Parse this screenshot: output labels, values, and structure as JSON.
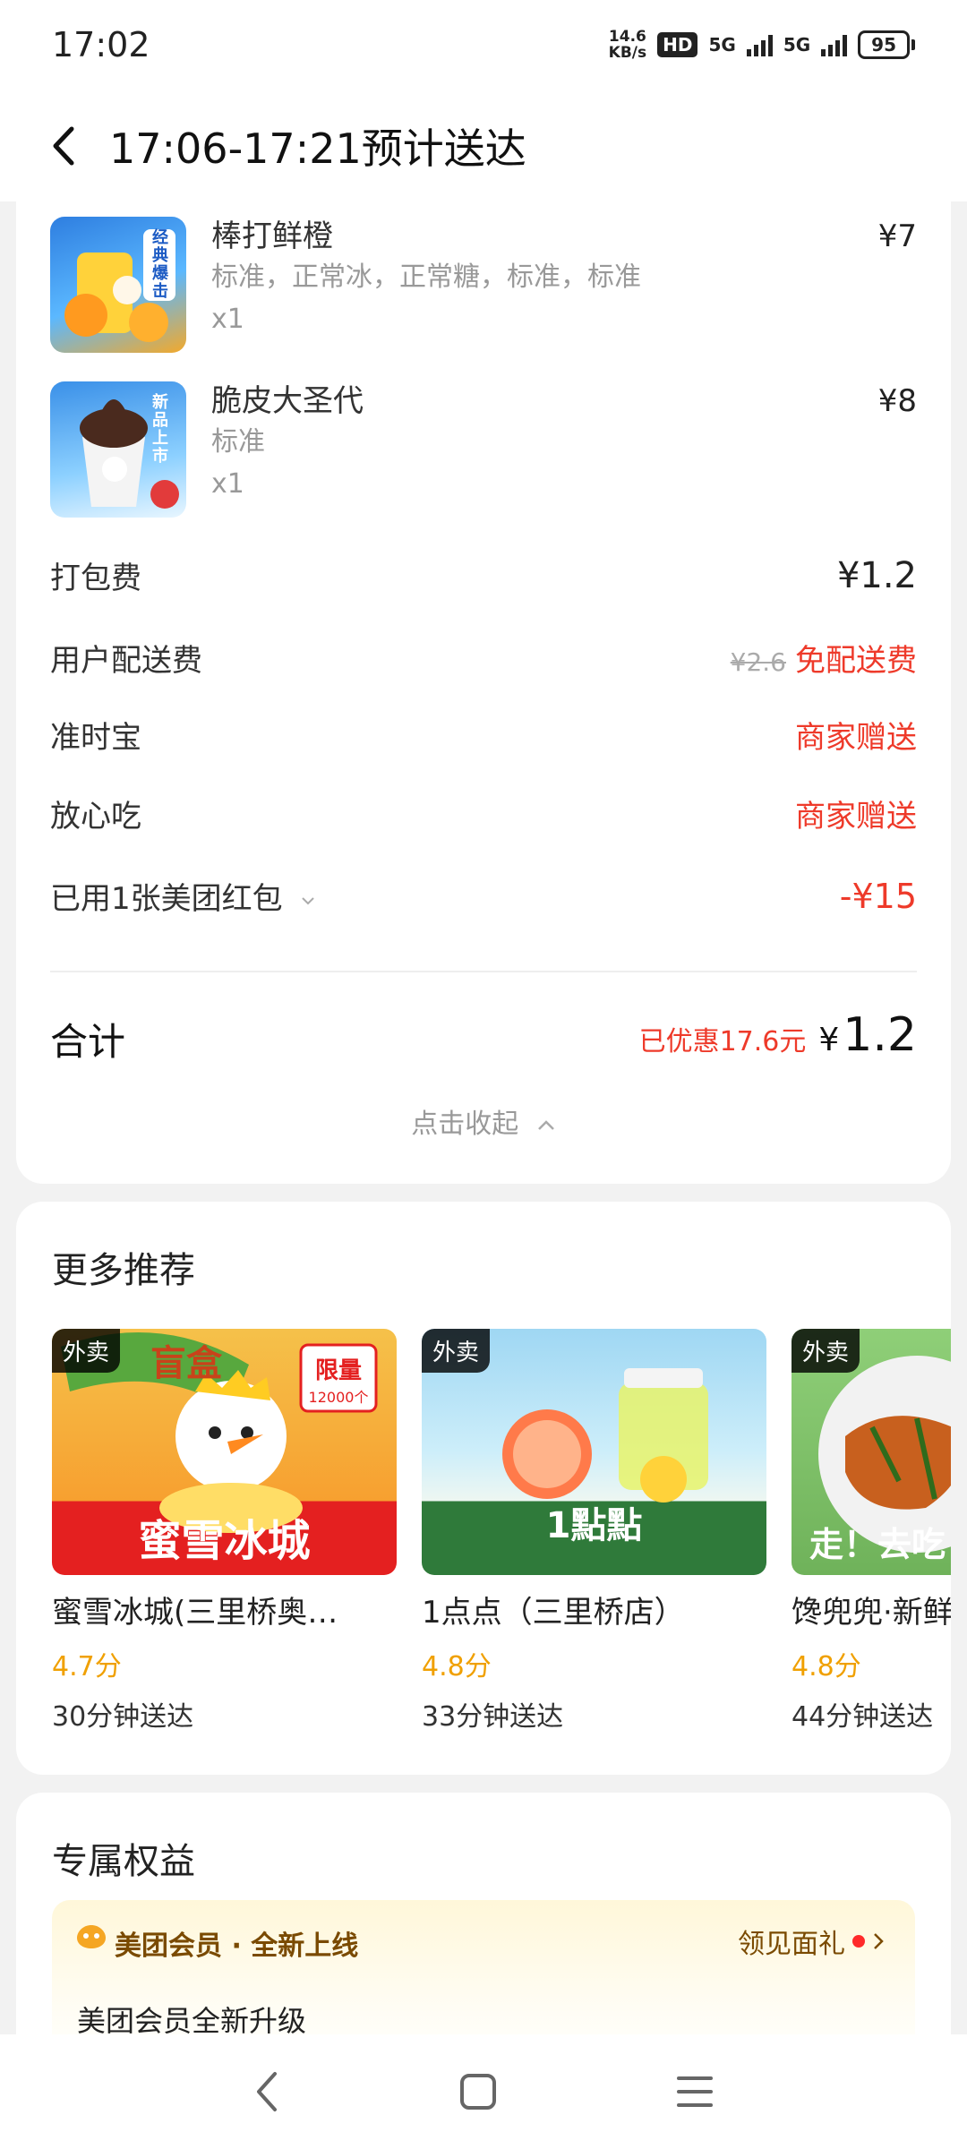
{
  "status_bar": {
    "time": "17:02",
    "speed_value": "14.6",
    "speed_unit": "KB/s",
    "hd_label": "HD",
    "network1": "5G",
    "network2": "5G",
    "battery": "95"
  },
  "header": {
    "title": "17:06-17:21预计送达"
  },
  "order": {
    "items": [
      {
        "name": "棒打鲜橙",
        "spec": "标准，正常冰，正常糖，标准，标准",
        "qty": "x1",
        "price": "¥7",
        "badge": "经典爆击"
      },
      {
        "name": "脆皮大圣代",
        "spec": "标准",
        "qty": "x1",
        "price": "¥8",
        "badge": "新品上市"
      }
    ],
    "fees": {
      "packing_label": "打包费",
      "packing_value": "¥1.2",
      "delivery_label": "用户配送费",
      "delivery_original": "¥2.6",
      "delivery_value": "免配送费",
      "ontime_label": "准时宝",
      "ontime_value": "商家赠送",
      "safe_label": "放心吃",
      "safe_value": "商家赠送",
      "coupon_label": "已用1张美团红包",
      "coupon_value": "-¥15"
    },
    "total_label": "合计",
    "discount_text": "已优惠17.6元",
    "total_currency": "¥",
    "total_amount": "1.2",
    "collapse_text": "点击收起"
  },
  "recommend": {
    "title": "更多推荐",
    "shops": [
      {
        "tag": "外卖",
        "name": "蜜雪冰城(三里桥奥…",
        "rating": "4.7分",
        "eta": "30分钟送达",
        "banner": "蜜雪冰城",
        "limit": "限量",
        "limit_count": "12000个",
        "promo": "盲盒"
      },
      {
        "tag": "外卖",
        "name": "1点点（三里桥店）",
        "rating": "4.8分",
        "eta": "33分钟送达",
        "banner": "1點點"
      },
      {
        "tag": "外卖",
        "name": "馋兜兜·新鲜",
        "rating": "4.8分",
        "eta": "44分钟送达",
        "promo": "走！去吃"
      }
    ]
  },
  "benefits": {
    "title": "专属权益",
    "member_title": "美团会员 · 全新上线",
    "member_link": "领见面礼",
    "member_desc": "美团会员全新升级"
  },
  "colors": {
    "accent_red": "#ee3a2a",
    "rating_orange": "#f0a000",
    "member_brown": "#7a4a00"
  }
}
